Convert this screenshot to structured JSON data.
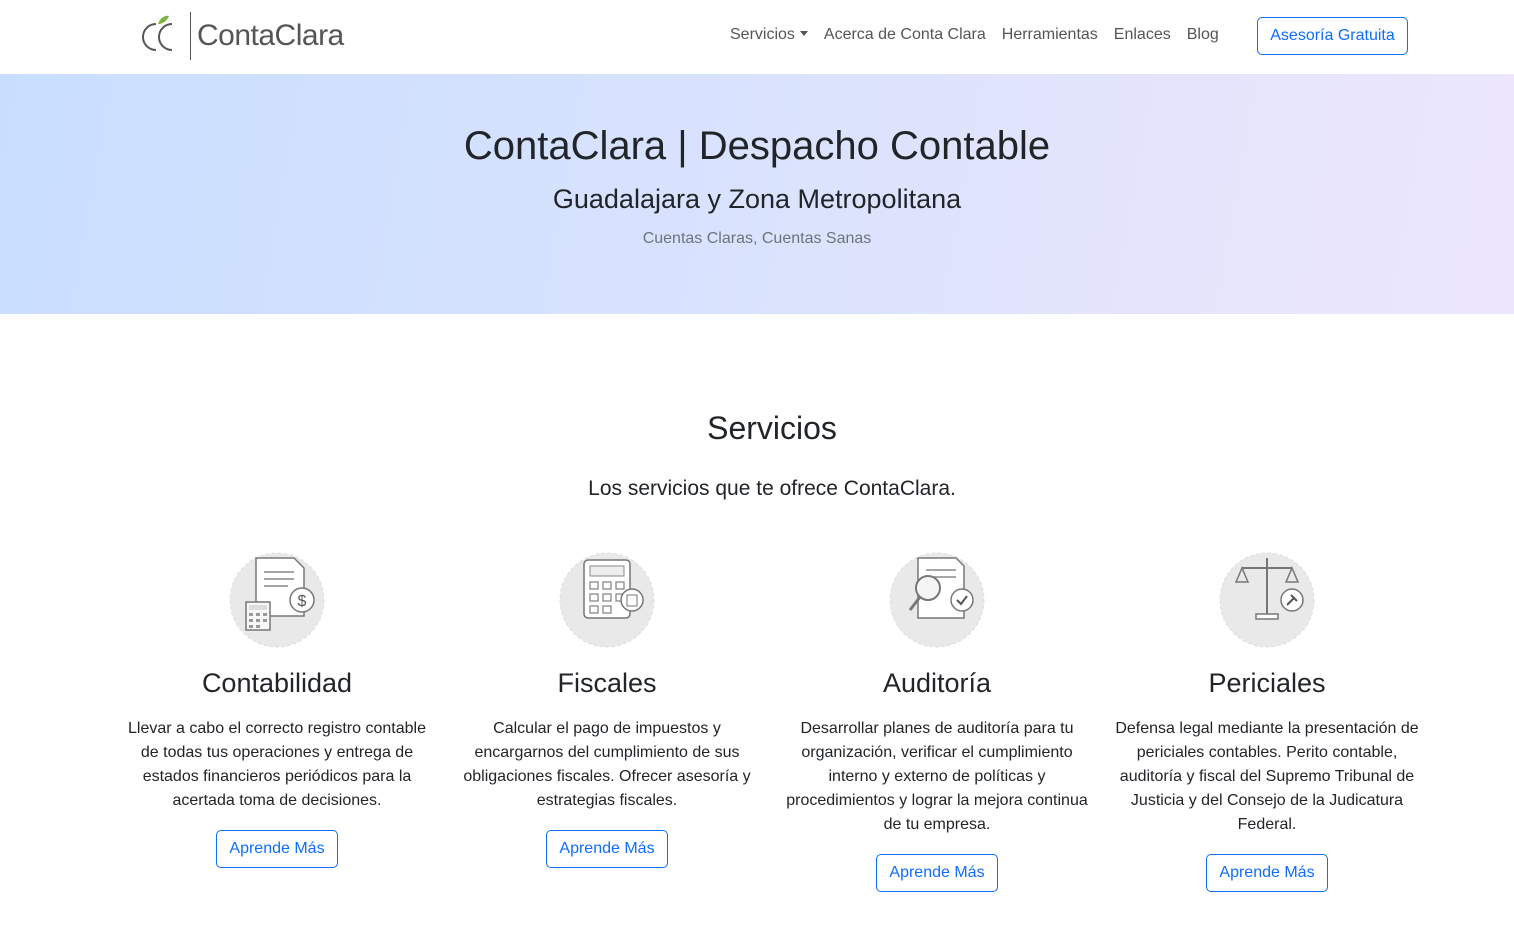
{
  "navbar": {
    "logo": {
      "mark": "CC",
      "text": "ContaClara"
    },
    "links": [
      {
        "label": "Servicios",
        "dropdown": true
      },
      {
        "label": "Acerca de Conta Clara",
        "dropdown": false
      },
      {
        "label": "Herramientas",
        "dropdown": false
      },
      {
        "label": "Enlaces",
        "dropdown": false
      },
      {
        "label": "Blog",
        "dropdown": false
      }
    ],
    "cta": "Asesoría Gratuita"
  },
  "hero": {
    "title": "ContaClara | Despacho Contable",
    "subtitle": "Guadalajara y Zona Metropolitana",
    "tagline": "Cuentas Claras, Cuentas Sanas"
  },
  "services": {
    "title": "Servicios",
    "lead": "Los servicios que te ofrece ContaClara.",
    "items": [
      {
        "icon": "accounting-document-icon",
        "title": "Contabilidad",
        "text": "Llevar a cabo el correcto registro contable de todas tus operaciones y entrega de estados financieros periódicos para la acertada toma de decisiones.",
        "button": "Aprende Más"
      },
      {
        "icon": "calculator-icon",
        "title": "Fiscales",
        "text": "Calcular el pago de impuestos y encargarnos del cumplimiento de sus obligaciones fiscales. Ofrecer asesoría y estrategias fiscales.",
        "button": "Aprende Más"
      },
      {
        "icon": "audit-magnifier-icon",
        "title": "Auditoría",
        "text": "Desarrollar planes de auditoría para tu organización, verificar el cumplimiento interno y externo de políticas y procedimientos y lograr la mejora continua de tu empresa.",
        "button": "Aprende Más"
      },
      {
        "icon": "justice-scale-icon",
        "title": "Periciales",
        "text": "Defensa legal mediante la presentación de periciales contables. Perito contable, auditoría y fiscal del Supremo Tribunal de Justicia y del Consejo de la Judicatura Federal.",
        "button": "Aprende Más"
      }
    ]
  },
  "colors": {
    "primary": "#0d6efd",
    "logo_leaf": "#7cb342"
  }
}
